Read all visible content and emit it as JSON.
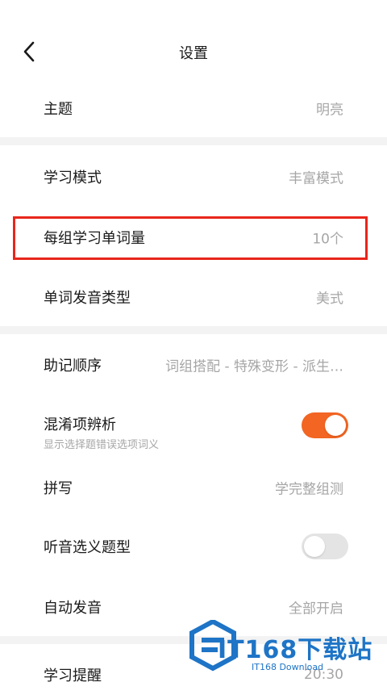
{
  "header": {
    "title": "设置",
    "back_icon": "chevron-left-icon"
  },
  "settings": {
    "theme": {
      "label": "主题",
      "value": "明亮"
    },
    "study_mode": {
      "label": "学习模式",
      "value": "丰富模式"
    },
    "words_per_group": {
      "label": "每组学习单词量",
      "value": "10个"
    },
    "pronunciation_type": {
      "label": "单词发音类型",
      "value": "美式"
    },
    "mnemonic_order": {
      "label": "助记顺序",
      "value": "词组搭配 - 特殊变形 - 派生…"
    },
    "confusing_options": {
      "label": "混淆项辨析",
      "sublabel": "显示选择题错误选项词义",
      "enabled": true
    },
    "spelling": {
      "label": "拼写",
      "value": "学完整组测"
    },
    "listening_quiz": {
      "label": "听音选义题型",
      "enabled": false
    },
    "auto_pronounce": {
      "label": "自动发音",
      "value": "全部开启"
    },
    "study_reminder": {
      "label": "学习提醒",
      "value": "20:30"
    }
  },
  "colors": {
    "accent": "#f26522",
    "highlight_box": "#e8261b",
    "divider": "#f3f3f3",
    "value_text": "#a6a6a6"
  },
  "watermark": {
    "title": "IT168下载站",
    "subtitle": "IT168 Download"
  }
}
